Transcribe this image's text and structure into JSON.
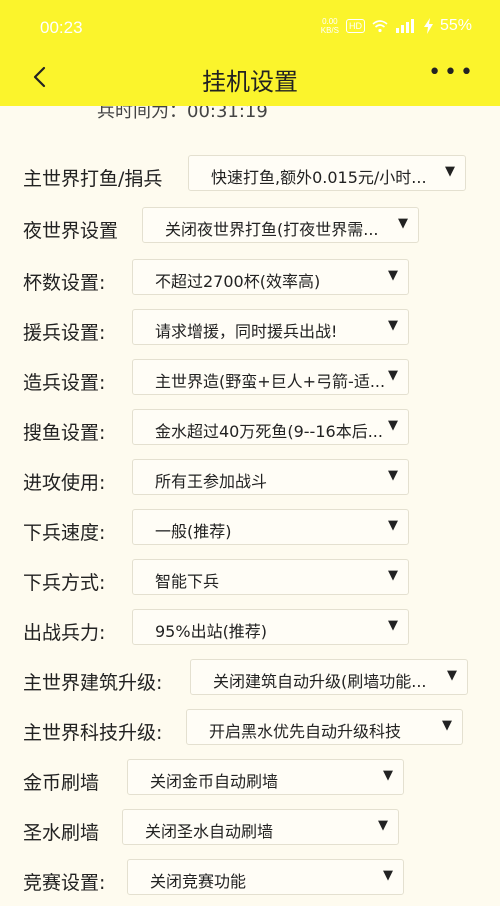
{
  "status": {
    "time": "00:23",
    "speed_value": "0.00",
    "speed_unit": "KB/S",
    "hd": "HD",
    "battery": "55%"
  },
  "header": {
    "title": "挂机设置"
  },
  "partial_text": "兵时间为：00:31:19",
  "settings": [
    {
      "label": "主世界打鱼/捐兵",
      "value": "快速打鱼,额外0.015元/小时..."
    },
    {
      "label": "夜世界设置",
      "value": "关闭夜世界打鱼(打夜世界需..."
    },
    {
      "label": "杯数设置:",
      "value": "不超过2700杯(效率高)"
    },
    {
      "label": "援兵设置:",
      "value": "请求增援，同时援兵出战!"
    },
    {
      "label": "造兵设置:",
      "value": "主世界造(野蛮+巨人+弓箭-适..."
    },
    {
      "label": "搜鱼设置:",
      "value": "金水超过40万死鱼(9--16本后..."
    },
    {
      "label": "进攻使用:",
      "value": "所有王参加战斗"
    },
    {
      "label": "下兵速度:",
      "value": "一般(推荐)"
    },
    {
      "label": "下兵方式:",
      "value": "智能下兵"
    },
    {
      "label": "出战兵力:",
      "value": "95%出站(推荐)"
    },
    {
      "label": "主世界建筑升级:",
      "value": "关闭建筑自动升级(刷墙功能..."
    },
    {
      "label": "主世界科技升级:",
      "value": "开启黑水优先自动升级科技"
    },
    {
      "label": "金币刷墙",
      "value": "关闭金币自动刷墙"
    },
    {
      "label": "圣水刷墙",
      "value": "关闭圣水自动刷墙"
    },
    {
      "label": "竞赛设置:",
      "value": "关闭竞赛功能"
    }
  ]
}
